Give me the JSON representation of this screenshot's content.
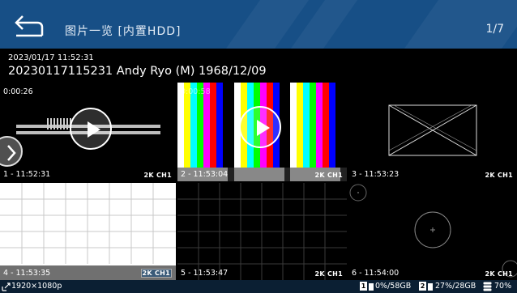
{
  "header": {
    "title": "图片一览 [内置HDD]",
    "page_indicator": "1/7"
  },
  "info": {
    "datetime": "2023/01/17 11:52:31",
    "filename": "20230117115231 Andy Ryo (M) 1968/12/09"
  },
  "thumbnails": [
    {
      "caption": "1 - 11:52:31",
      "format": "2K CH1",
      "duration": "0:00:26",
      "type": "video",
      "selected": true
    },
    {
      "caption": "2 - 11:53:04",
      "format": "2K CH1",
      "duration": "0:00:58",
      "type": "video",
      "selected": false
    },
    {
      "caption": "3 - 11:53:23",
      "format": "2K CH1",
      "type": "image",
      "selected": false
    },
    {
      "caption": "4 - 11:53:35",
      "format": "2K CH1",
      "type": "image",
      "selected": false
    },
    {
      "caption": "5 - 11:53:47",
      "format": "2K CH1",
      "type": "image",
      "selected": false
    },
    {
      "caption": "6 - 11:54:00",
      "format": "2K CH1",
      "type": "image",
      "selected": false
    }
  ],
  "status": {
    "resolution": "1920×1080p",
    "drive1_label": "1",
    "drive1": "0%/58GB",
    "drive2_label": "2",
    "drive2": "27%/28GB",
    "storage": "70%"
  },
  "colors": {
    "header_bg": "#174f86",
    "status_bg": "#0b1f33",
    "bars": [
      "#ffffff",
      "#ffff00",
      "#00ffff",
      "#00ff00",
      "#ff00ff",
      "#ff0000",
      "#0000ff",
      "#000000"
    ]
  },
  "icons": [
    "back-icon",
    "play-icon",
    "chevron-left-icon",
    "signal-icon",
    "drive-icon",
    "storage-icon"
  ]
}
